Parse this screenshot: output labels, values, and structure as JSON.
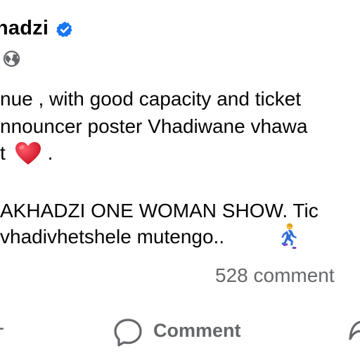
{
  "post": {
    "author_name": "hadzi",
    "meta_separator": "·",
    "body_lines": [
      "nue , with good capacity and ticket",
      "nnouncer poster  Vhadiwane vhawa",
      "t",
      "AKHADZI ONE WOMAN SHOW.  Tic",
      "vhadivhetshele mutengo.."
    ],
    "line3_tail": ".",
    "comments_count": "528 comment"
  },
  "actions": {
    "comment_label": "Comment"
  },
  "icons": {
    "verified": "verified-badge-icon",
    "audience": "globe-icon",
    "heart": "red-heart-emoji",
    "runner": "woman-running-emoji",
    "comment": "comment-bubble-icon",
    "share": "share-arrow-icon"
  },
  "colors": {
    "verified_blue": "#1877f2",
    "secondary_text": "#65676b",
    "heart_red": "#e0162b"
  }
}
